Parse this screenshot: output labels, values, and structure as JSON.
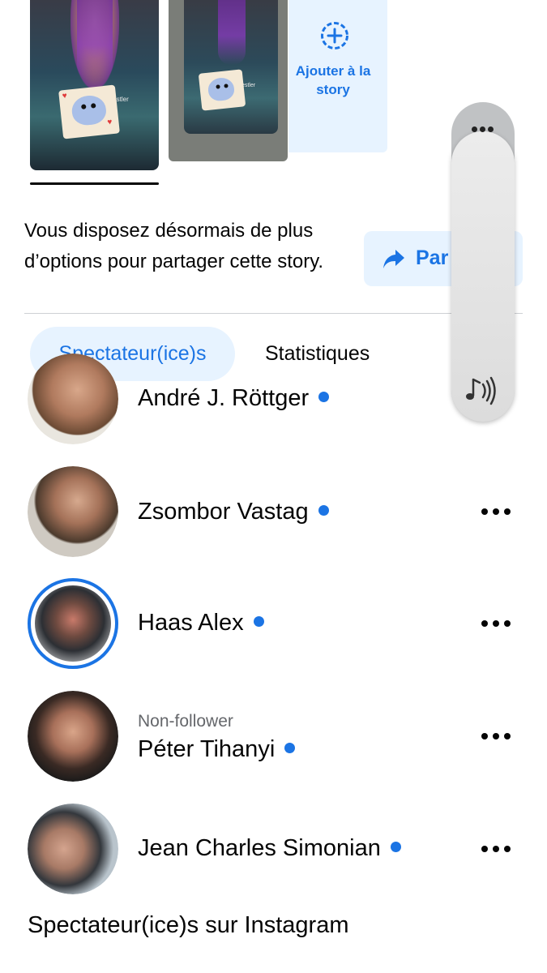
{
  "stories": {
    "thumb1_handle": "rhio_wrestler",
    "thumb2_handle": "rhio_wrestler",
    "add_story_label": "Ajouter à la story"
  },
  "share": {
    "notice": "Vous disposez désormais de plus d’options pour partager cette story.",
    "button_label": "Par"
  },
  "tabs": [
    {
      "label": "Spectateur(ice)s",
      "active": true
    },
    {
      "label": "Statistiques",
      "active": false
    }
  ],
  "viewers": [
    {
      "name": "André J. Röttger",
      "sub": "",
      "has_more": false,
      "ring": false
    },
    {
      "name": "Zsombor Vastag",
      "sub": "",
      "has_more": true,
      "ring": false
    },
    {
      "name": "Haas Alex",
      "sub": "",
      "has_more": true,
      "ring": true
    },
    {
      "name": "Péter Tihanyi",
      "sub": "Non-follower",
      "has_more": true,
      "ring": false
    },
    {
      "name": "Jean Charles Simonian",
      "sub": "",
      "has_more": true,
      "ring": false
    }
  ],
  "instagram_section_title": "Spectateur(ice)s sur Instagram",
  "colors": {
    "accent": "#1b74e4",
    "accent_bg": "#e7f3ff",
    "text": "#050505",
    "secondary_text": "#65676b"
  },
  "icons": {
    "add_story": "plus-circle-icon",
    "share": "share-arrow-icon",
    "more": "more-dots-icon",
    "volume": "music-note-sound-icon"
  }
}
